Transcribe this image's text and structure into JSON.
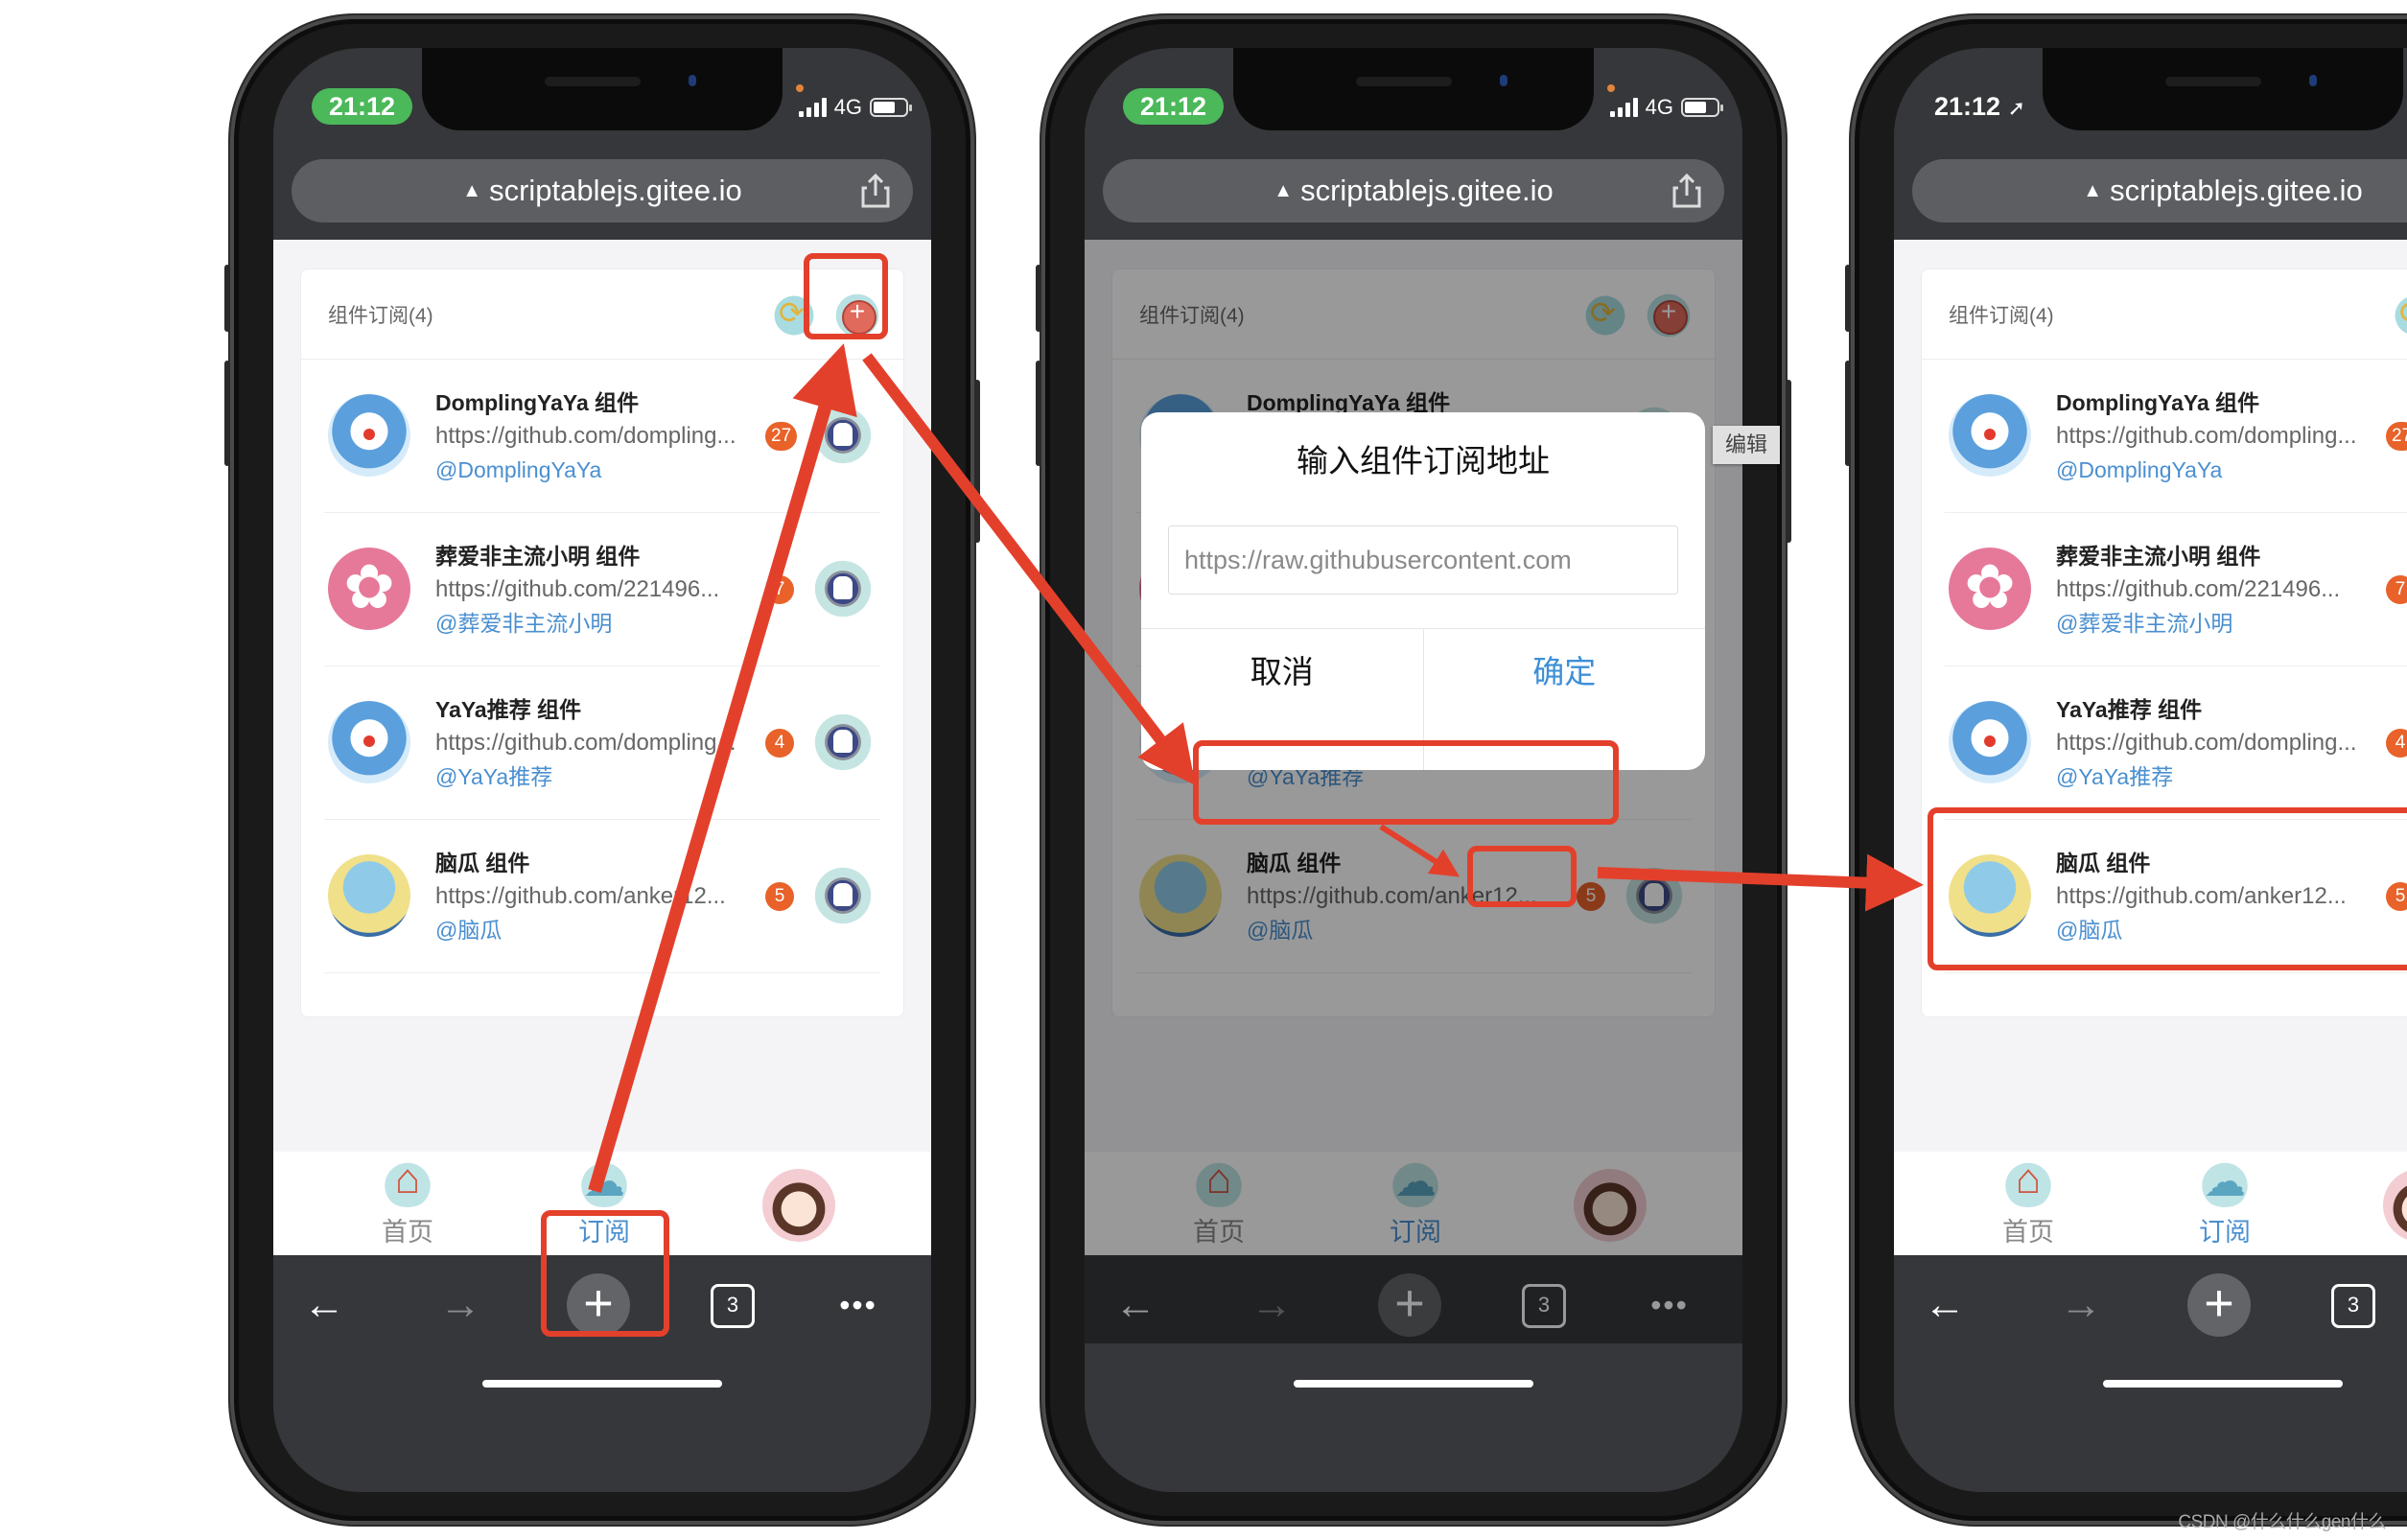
{
  "watermark": "CSDN @什么什么gen什么",
  "browser": {
    "url": "scriptablejs.gitee.io",
    "url_warning_icon": "warning-triangle-icon",
    "share_icon": "share-icon",
    "tab_count": "3",
    "back_icon": "←",
    "forward_icon": "→",
    "new_tab_icon": "+",
    "more_icon": "•••"
  },
  "status": {
    "time": "21:12",
    "network": "4G",
    "location_arrow": "➚"
  },
  "card": {
    "title": "组件订阅(4)",
    "refresh_icon": "refresh-cloud-icon",
    "add_icon": "add-cloud-icon"
  },
  "subscriptions": [
    {
      "title": "DomplingYaYa 组件",
      "url": "https://github.com/dompling...",
      "author": "@DomplingYaYa",
      "count": "27",
      "avatar": "doraemon"
    },
    {
      "title": "葬爱非主流小明 组件",
      "url": "https://github.com/221496...",
      "author": "@葬爱非主流小明",
      "count": "7",
      "avatar": "clover"
    },
    {
      "title": "YaYa推荐 组件",
      "url": "https://github.com/dompling...",
      "author": "@YaYa推荐",
      "count": "4",
      "avatar": "doraemon"
    },
    {
      "title": "脑瓜 组件",
      "url": "https://github.com/anker12...",
      "author": "@脑瓜",
      "count": "5",
      "avatar": "squirtle"
    }
  ],
  "tabbar": {
    "home": "首页",
    "subscribe": "订阅",
    "active": "订阅"
  },
  "dialog": {
    "title": "输入组件订阅地址",
    "input_value": "https://raw.githubusercontent.com",
    "cancel": "取消",
    "confirm": "确定"
  },
  "tooltip": "编辑",
  "colors": {
    "accent_blue": "#4a8fd0",
    "badge_orange": "#e8622a",
    "highlight_red": "#e3402c",
    "status_green": "#4bb85a"
  }
}
